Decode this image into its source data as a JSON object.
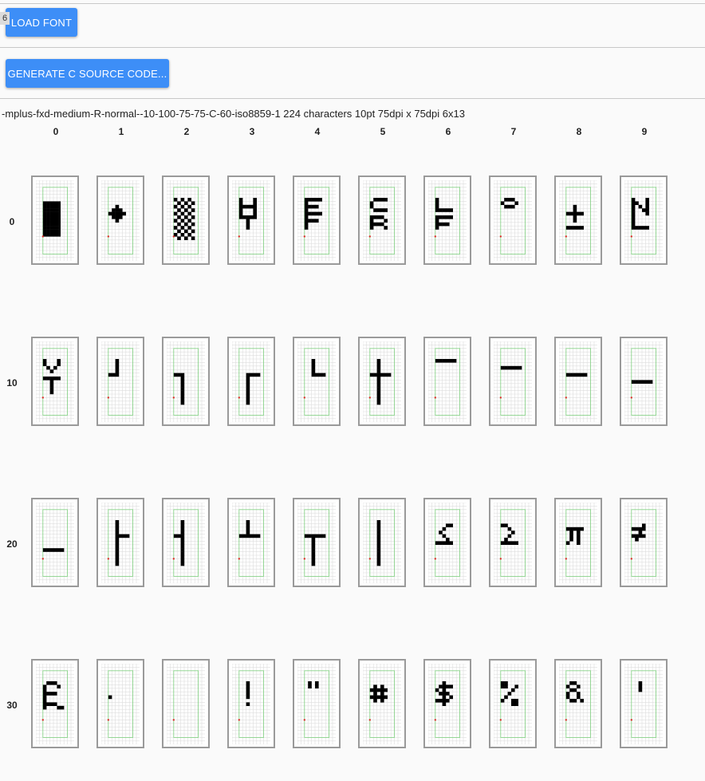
{
  "toolbar": {
    "load_font_label": "LOAD FONT",
    "badge": "6",
    "generate_label": "GENERATE C SOURCE CODE..."
  },
  "font_info": "-mplus-fxd-medium-R-normal--10-100-75-75-C-60-iso8859-1 224 characters 10pt 75dpi x 75dpi 6x13",
  "columns": [
    "0",
    "1",
    "2",
    "3",
    "4",
    "5",
    "6",
    "7",
    "8",
    "9"
  ],
  "rows": [
    "0",
    "10",
    "20",
    "30"
  ],
  "colors": {
    "button": "#3d8ef7",
    "pixel": "#000000",
    "guide": "#7fd07f",
    "origin": "#e02020",
    "grid": "#dddddd"
  },
  "glyphs": [
    [
      "......",
      "#####.",
      "#####.",
      "#####.",
      "#####.",
      "#####.",
      "#####.",
      "#####.",
      "#####.",
      "#####.",
      "#####.",
      "......",
      "......"
    ],
    [
      "......",
      "......",
      "..#...",
      ".###..",
      "#####.",
      ".###..",
      "..#...",
      "......",
      "......",
      "......",
      "......",
      "......",
      "......"
    ],
    [
      "#.#.#.",
      ".#.#.#",
      "#.#.#.",
      ".#.#.#",
      "#.#.#.",
      ".#.#.#",
      "#.#.#.",
      ".#.#.#",
      "#.#.#.",
      ".#.#.#",
      "#.#.#.",
      ".#.#.#",
      "......"
    ],
    [
      "#...#.",
      "#...#.",
      "#####.",
      "#...#.",
      "#...#.",
      "#####.",
      "..#...",
      "..#...",
      "..#...",
      "......",
      "......",
      "......",
      "......"
    ],
    [
      "#####.",
      "#.....",
      "####..",
      "#.....",
      "#####.",
      "#.....",
      "####..",
      "#.....",
      "#.....",
      "......",
      "......",
      "......",
      "......"
    ],
    [
      ".####.",
      "#.....",
      "#.....",
      ".####.",
      "......",
      "####..",
      "#...#.",
      "####..",
      "#...#.",
      "......",
      "......",
      "......",
      "......"
    ],
    [
      "#.....",
      "#.....",
      "#.....",
      "#####.",
      "......",
      "#####.",
      "#.....",
      "####..",
      "#.....",
      "......",
      "......",
      "......",
      "......"
    ],
    [
      ".###..",
      "#...#.",
      ".###..",
      "......",
      "......",
      "......",
      "......",
      "......",
      "......",
      "......",
      "......",
      "......",
      "......"
    ],
    [
      "......",
      "......",
      "..#...",
      "..#...",
      "#####.",
      "..#...",
      "..#...",
      "......",
      "#####.",
      "......",
      "......",
      "......",
      "......"
    ],
    [
      "#...#.",
      "##..#.",
      "#.#.#.",
      "#..##.",
      "#...#.",
      "#.....",
      "#.....",
      "#.....",
      "#####.",
      "......",
      "......",
      "......",
      "......"
    ],
    [
      "#...#.",
      "#...#.",
      ".#.#..",
      "..#...",
      "......",
      "#####.",
      "..#...",
      "..#...",
      "..#...",
      "..#...",
      "......",
      "......",
      "......"
    ],
    [
      "..#...",
      "..#...",
      "..#...",
      "..#...",
      "###...",
      "......",
      "......",
      "......",
      "......",
      "......",
      "......",
      "......",
      "......"
    ],
    [
      "......",
      "......",
      "......",
      "......",
      "###...",
      "..#...",
      "..#...",
      "..#...",
      "..#...",
      "..#...",
      "..#...",
      "..#...",
      "..#..."
    ],
    [
      "......",
      "......",
      "......",
      "......",
      "..####",
      "..#...",
      "..#...",
      "..#...",
      "..#...",
      "..#...",
      "..#...",
      "..#...",
      "..#..."
    ],
    [
      "..#...",
      "..#...",
      "..#...",
      "..#...",
      "..####",
      "......",
      "......",
      "......",
      "......",
      "......",
      "......",
      "......",
      "......"
    ],
    [
      "..#...",
      "..#...",
      "..#...",
      "..#...",
      "######",
      "..#...",
      "..#...",
      "..#...",
      "..#...",
      "..#...",
      "..#...",
      "..#...",
      "..#..."
    ],
    [
      "######",
      "......",
      "......",
      "......",
      "......",
      "......",
      "......",
      "......",
      "......",
      "......",
      "......",
      "......",
      "......"
    ],
    [
      "......",
      "......",
      "######",
      "......",
      "......",
      "......",
      "......",
      "......",
      "......",
      "......",
      "......",
      "......",
      "......"
    ],
    [
      "......",
      "......",
      "......",
      "......",
      "######",
      "......",
      "......",
      "......",
      "......",
      "......",
      "......",
      "......",
      "......"
    ],
    [
      "......",
      "......",
      "......",
      "......",
      "......",
      "......",
      "######",
      "......",
      "......",
      "......",
      "......",
      "......",
      "......"
    ],
    [
      "......",
      "......",
      "......",
      "......",
      "......",
      "......",
      "......",
      "......",
      "######",
      "......",
      "......",
      "......",
      "......"
    ],
    [
      "..#...",
      "..#...",
      "..#...",
      "..#...",
      "..####",
      "..#...",
      "..#...",
      "..#...",
      "..#...",
      "..#...",
      "..#...",
      "..#...",
      "..#..."
    ],
    [
      "..#...",
      "..#...",
      "..#...",
      "..#...",
      "###...",
      "..#...",
      "..#...",
      "..#...",
      "..#...",
      "..#...",
      "..#...",
      "..#...",
      "..#..."
    ],
    [
      "..#...",
      "..#...",
      "..#...",
      "..#...",
      "######",
      "......",
      "......",
      "......",
      "......",
      "......",
      "......",
      "......",
      "......"
    ],
    [
      "......",
      "......",
      "......",
      "......",
      "######",
      "..#...",
      "..#...",
      "..#...",
      "..#...",
      "..#...",
      "..#...",
      "..#...",
      "..#..."
    ],
    [
      "..#...",
      "..#...",
      "..#...",
      "..#...",
      "..#...",
      "..#...",
      "..#...",
      "..#...",
      "..#...",
      "..#...",
      "..#...",
      "..#...",
      "..#..."
    ],
    [
      "......",
      "...##.",
      "..#...",
      ".#....",
      "..#...",
      "...#..",
      "#####.",
      "......",
      "......",
      "......",
      "......",
      "......",
      "......"
    ],
    [
      "......",
      "##....",
      "..#...",
      "...#..",
      "..#...",
      ".#....",
      "#####.",
      "......",
      "......",
      "......",
      "......",
      "......",
      "......"
    ],
    [
      "......",
      "......",
      "#####.",
      ".#.#..",
      ".#.#..",
      ".#.#..",
      "#..#..",
      "......",
      "......",
      "......",
      "......",
      "......",
      "......"
    ],
    [
      "......",
      "...#..",
      "####..",
      "..#...",
      "####..",
      ".#....",
      "......",
      "......",
      "......",
      "......",
      "......",
      "......",
      "......"
    ],
    [
      ".###..",
      "#...#.",
      "#.....",
      "####..",
      "#.....",
      "#.....",
      "####..",
      "#...##",
      "......",
      "......",
      "......",
      "......",
      "......"
    ],
    [
      "......",
      "......",
      "......",
      "......",
      "#.....",
      "......",
      "......",
      "......",
      "......",
      "......",
      "......",
      "......",
      "......"
    ],
    [
      "......",
      "......",
      "......",
      "......",
      "......",
      "......",
      "......",
      "......",
      "......",
      "......",
      "......",
      "......",
      "......"
    ],
    [
      "..#...",
      "..#...",
      "..#...",
      "..#...",
      "..#...",
      "......",
      "..#...",
      "......",
      "......",
      "......",
      "......",
      "......",
      "......"
    ],
    [
      ".#.#..",
      ".#.#..",
      "......",
      "......",
      "......",
      "......",
      "......",
      "......",
      "......",
      "......",
      "......",
      "......",
      "......"
    ],
    [
      "......",
      ".#.#..",
      "#####.",
      ".#.#..",
      "#####.",
      ".#.#..",
      "......",
      "......",
      "......",
      "......",
      "......",
      "......",
      "......"
    ],
    [
      "..#...",
      ".####.",
      "#.#...",
      ".###..",
      "..#.#.",
      "####..",
      "..#...",
      "......",
      "......",
      "......",
      "......",
      "......",
      "......"
    ],
    [
      "##....",
      "##..#.",
      "...#..",
      "..#...",
      ".#....",
      "#..##.",
      "...##.",
      "......",
      "......",
      "......",
      "......",
      "......",
      "......"
    ],
    [
      ".##...",
      "#..#..",
      ".##...",
      "#..#..",
      "#..#..",
      ".##.#.",
      "......",
      "......",
      "......",
      "......",
      "......",
      "......",
      "......"
    ],
    [
      "..#...",
      "..#...",
      "..#...",
      "......",
      "......",
      "......",
      "......",
      "......",
      "......",
      "......",
      "......",
      "......",
      "......"
    ]
  ]
}
